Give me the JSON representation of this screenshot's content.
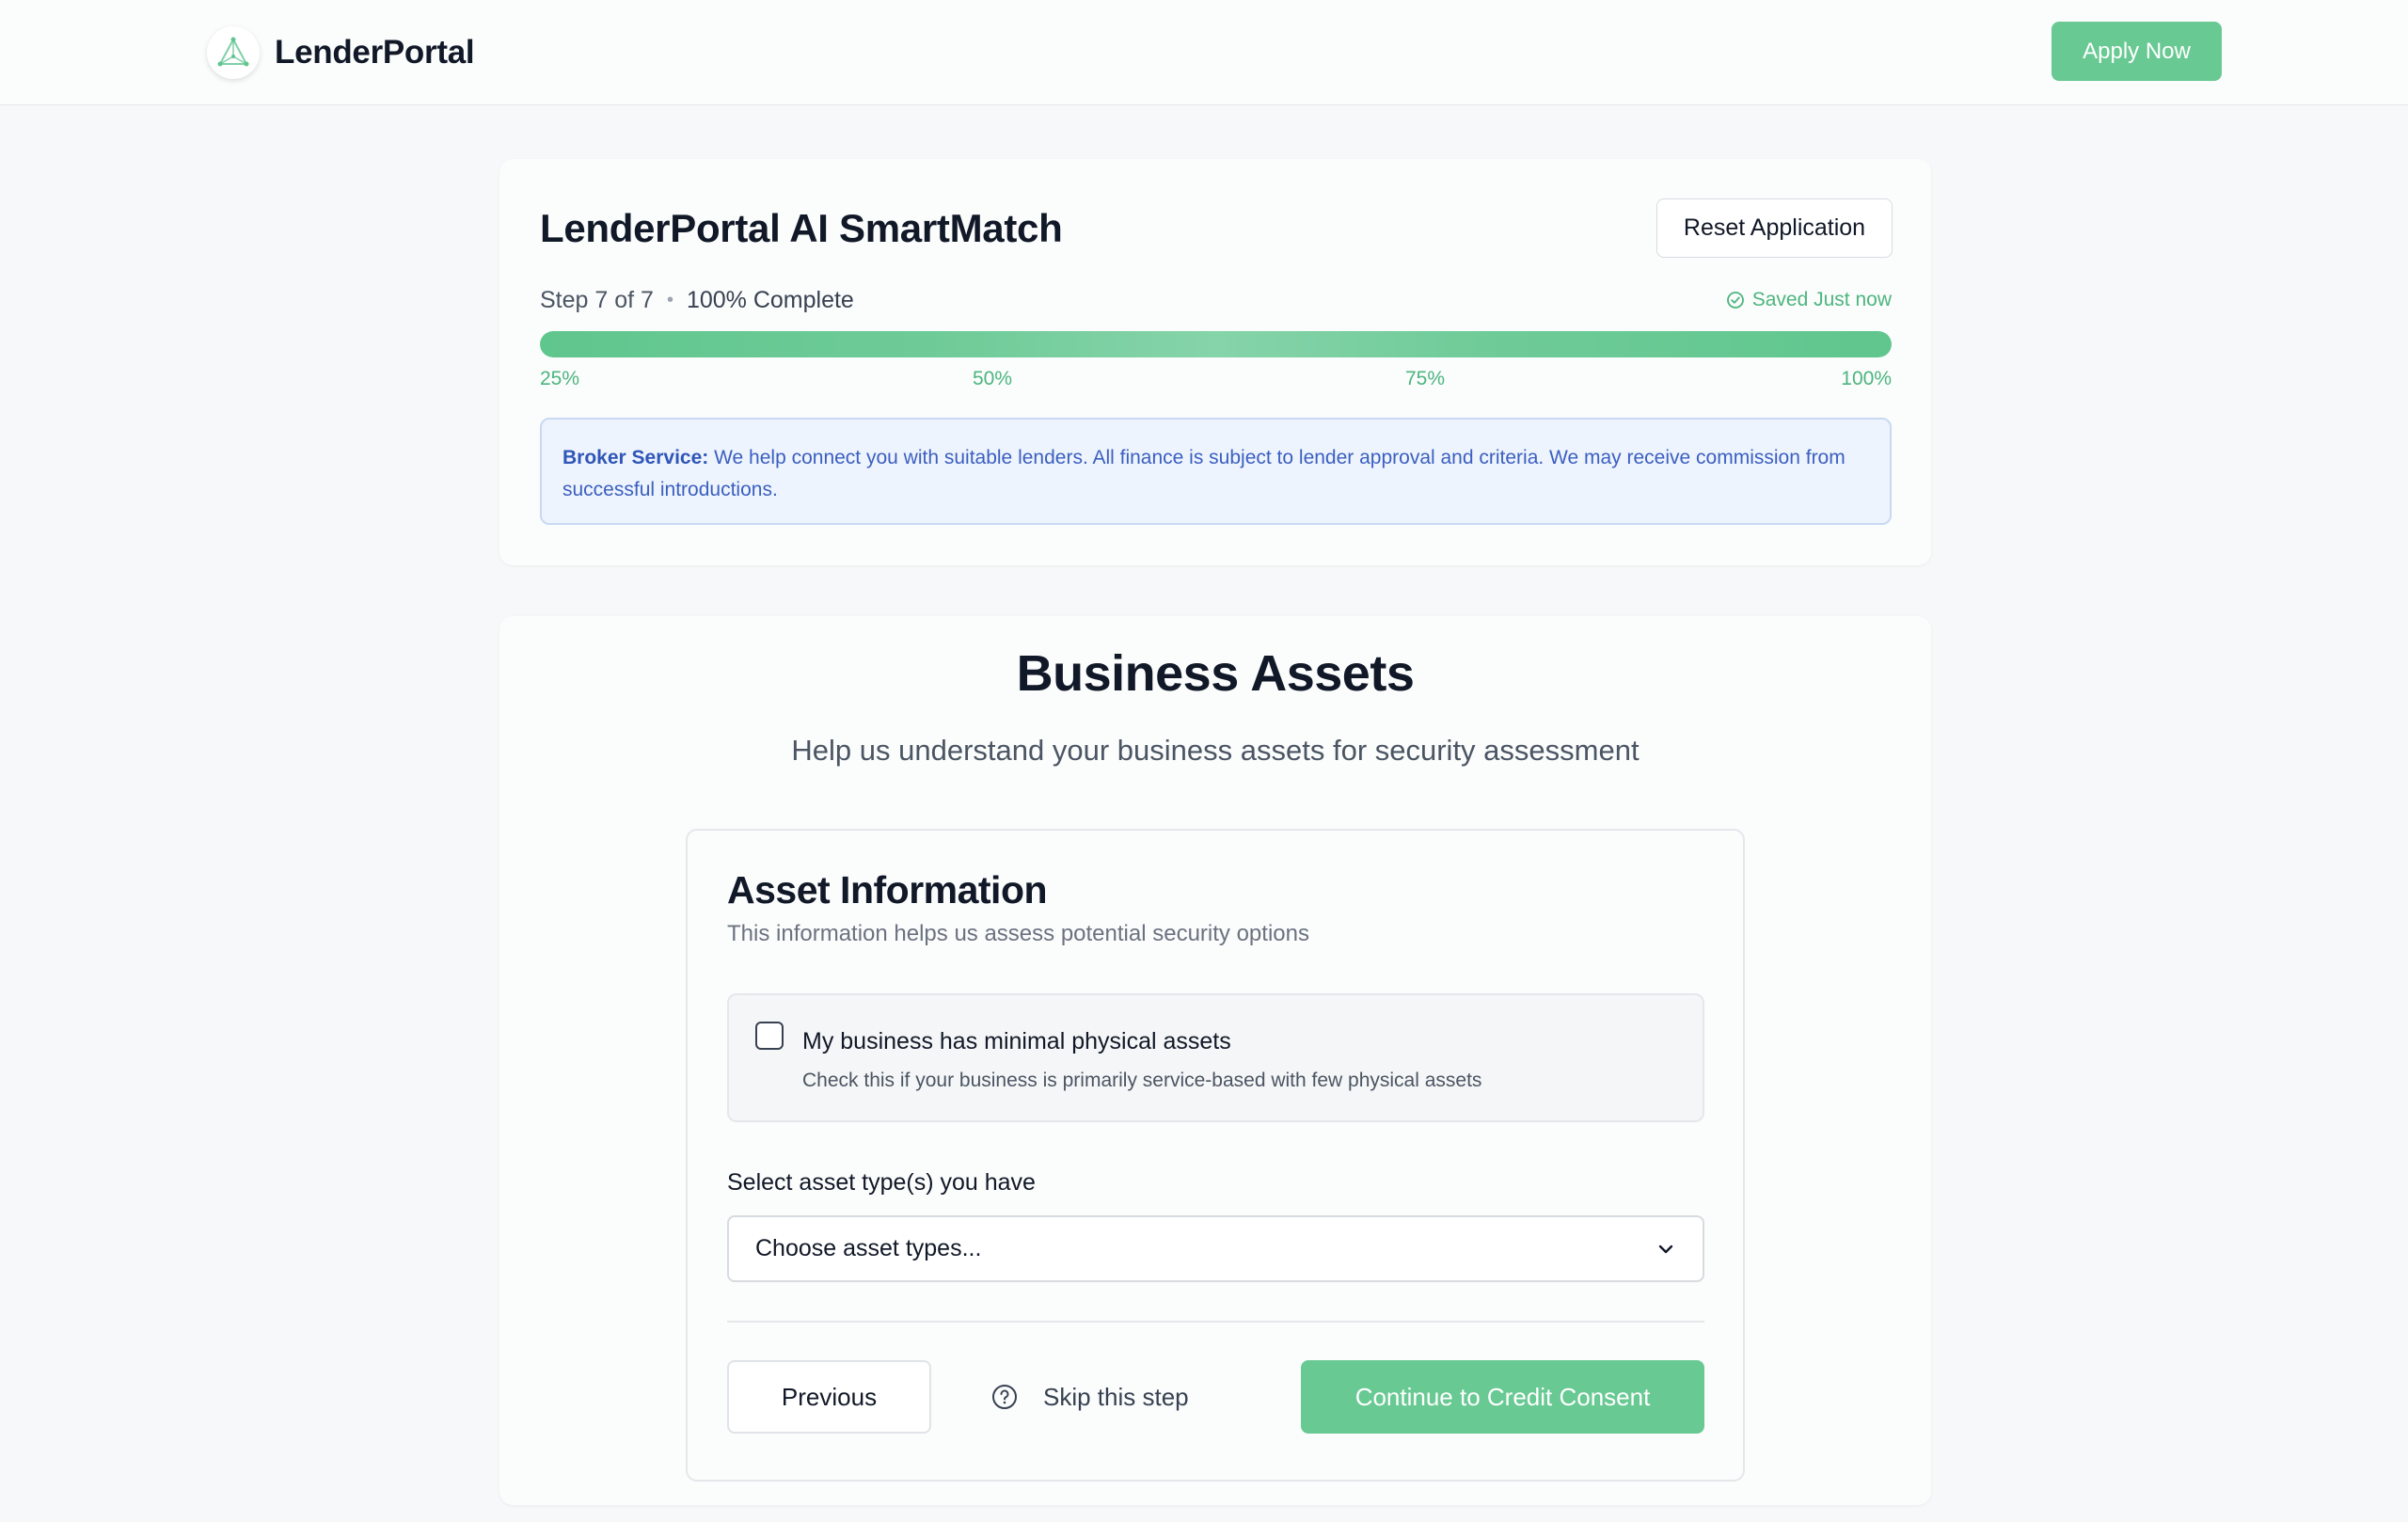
{
  "nav": {
    "brand_name": "LenderPortal",
    "logo_icon": "triangle-nodes-logo",
    "apply_label": "Apply Now",
    "accent_color": "#68c993"
  },
  "progress": {
    "app_title": "LenderPortal AI SmartMatch",
    "reset_label": "Reset Application",
    "step_text": "Step 7 of 7",
    "separator": "•",
    "percent_text": "100% Complete",
    "saved_text": "Saved Just now",
    "saved_icon": "check-circle-icon",
    "progress_value": 1.0,
    "markers": [
      "25%",
      "50%",
      "75%",
      "100%"
    ]
  },
  "notice": {
    "label": "Broker Service:",
    "text": " We help connect you with suitable lenders. All finance is subject to lender approval and criteria. We may receive commission from successful introductions."
  },
  "section": {
    "title": "Business Assets",
    "subtitle": "Help us understand your business assets for security assessment"
  },
  "asset_card": {
    "title": "Asset Information",
    "subtitle": "This information helps us assess potential security options",
    "checkbox_label": "My business has minimal physical assets",
    "checkbox_help": "Check this if your business is primarily service-based with few physical assets",
    "checkbox_checked": false,
    "select_label": "Select asset type(s) you have",
    "select_placeholder": "Choose asset types..."
  },
  "actions": {
    "previous_label": "Previous",
    "skip_label": "Skip this step",
    "skip_icon": "question-circle-icon",
    "continue_label": "Continue to Credit Consent"
  }
}
